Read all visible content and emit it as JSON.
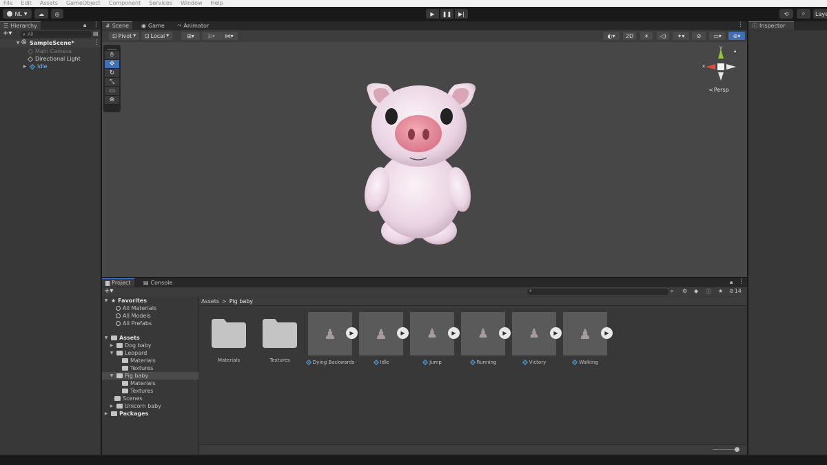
{
  "menu": [
    "File",
    "Edit",
    "Assets",
    "GameObject",
    "Component",
    "Services",
    "Window",
    "Help"
  ],
  "toolbar": {
    "account": "NL",
    "layers_label": "Laye"
  },
  "hierarchy": {
    "tab": "Hierarchy",
    "search_placeholder": "All",
    "scene": "SampleScene*",
    "items": [
      "Main Camera",
      "Directional Light",
      "Idle"
    ]
  },
  "scene_tabs": [
    "Scene",
    "Game",
    "Animator"
  ],
  "scene_toolbar": {
    "pivot": "Pivot",
    "local": "Local",
    "mode_2d": "2D",
    "persp": "Persp",
    "gizmo_x": "x",
    "gizmo_y": "y"
  },
  "inspector": {
    "tab": "Inspector"
  },
  "project": {
    "tabs": [
      "Project",
      "Console"
    ],
    "favorites": {
      "label": "Favorites",
      "items": [
        "All Materials",
        "All Models",
        "All Prefabs"
      ]
    },
    "assets_label": "Assets",
    "tree": [
      "Dog baby",
      "Leopard",
      "Materials",
      "Textures",
      "Pig baby",
      "Materials",
      "Textures",
      "Scenes",
      "Unicorn baby"
    ],
    "packages": "Packages",
    "breadcrumb": [
      "Assets",
      "Pig baby"
    ],
    "hidden_count": "14",
    "assets": [
      {
        "name": "Materials",
        "kind": "folder"
      },
      {
        "name": "Textures",
        "kind": "folder"
      },
      {
        "name": "Dying Backwards",
        "kind": "model"
      },
      {
        "name": "Idle",
        "kind": "model"
      },
      {
        "name": "Jump",
        "kind": "model"
      },
      {
        "name": "Running",
        "kind": "model"
      },
      {
        "name": "Victory",
        "kind": "model"
      },
      {
        "name": "Walking",
        "kind": "model"
      }
    ]
  },
  "colors": {
    "accent": "#4d7fd1",
    "panel": "#383838",
    "scene_bg": "#474747",
    "pig_body": "#f4e4ee",
    "pig_snout": "#e9909e"
  }
}
